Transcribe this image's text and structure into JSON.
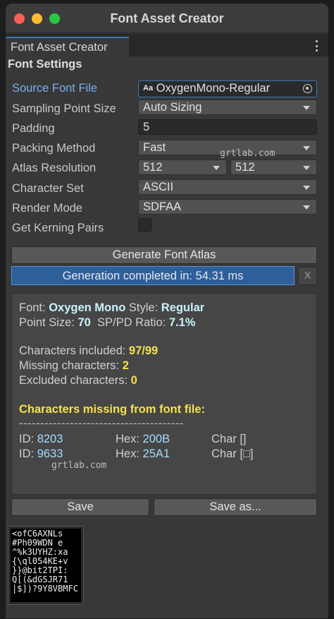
{
  "window": {
    "title": "Font Asset Creator",
    "traffic_lights": {
      "close": "#fe5f57",
      "minimize": "#febc2e",
      "zoom": "#28c840"
    }
  },
  "tab": {
    "label": "Font Asset Creator",
    "menu_icon": "kebab-menu-icon"
  },
  "font_settings": {
    "heading": "Font Settings",
    "source_font_file": {
      "label": "Source Font File",
      "value": "OxygenMono-Regular",
      "icon_text": "Aa"
    },
    "sampling_point_size": {
      "label": "Sampling Point Size",
      "value": "Auto Sizing"
    },
    "padding": {
      "label": "Padding",
      "value": "5"
    },
    "packing_method": {
      "label": "Packing Method",
      "value": "Fast"
    },
    "atlas_resolution": {
      "label": "Atlas Resolution",
      "width": "512",
      "height": "512"
    },
    "character_set": {
      "label": "Character Set",
      "value": "ASCII"
    },
    "render_mode": {
      "label": "Render Mode",
      "value": "SDFAA"
    },
    "get_kerning_pairs": {
      "label": "Get Kerning Pairs",
      "checked": false
    }
  },
  "generate_button": "Generate Font Atlas",
  "progress": {
    "text": "Generation completed in: 54.31 ms",
    "value": 1.0,
    "close_label": "X"
  },
  "info": {
    "font_label": "Font:",
    "font_value": "Oxygen Mono",
    "style_label": "Style:",
    "style_value": "Regular",
    "point_size_label": "Point Size:",
    "point_size_value": "70",
    "ratio_label": "SP/PD Ratio:",
    "ratio_value": "7.1%",
    "chars_included_label": "Characters included:",
    "chars_included_value": "97/99",
    "missing_label": "Missing characters:",
    "missing_value": "2",
    "excluded_label": "Excluded characters:",
    "excluded_value": "0",
    "missing_heading": "Characters missing from font file:",
    "divider": "---------------------------------------",
    "rows": [
      {
        "id_label": "ID:",
        "id": "8203",
        "hex_label": "Hex:",
        "hex": "200B",
        "char": "Char []"
      },
      {
        "id_label": "ID:",
        "id": "9633",
        "hex_label": "Hex:",
        "hex": "25A1",
        "char": "Char [□]"
      }
    ]
  },
  "watermark": "grtlab.com",
  "save_button": "Save",
  "save_as_button": "Save as...",
  "atlas_preview": {
    "lines": [
      "<ofC6AXΝLs",
      "#Ph09WDN e",
      "^%k3UYHZ:xa",
      "{\\ql054KE+v",
      "}}@bit2TPI:",
      "Q[(&dGSJR71",
      "|$])?9Y8VBMFC"
    ]
  }
}
